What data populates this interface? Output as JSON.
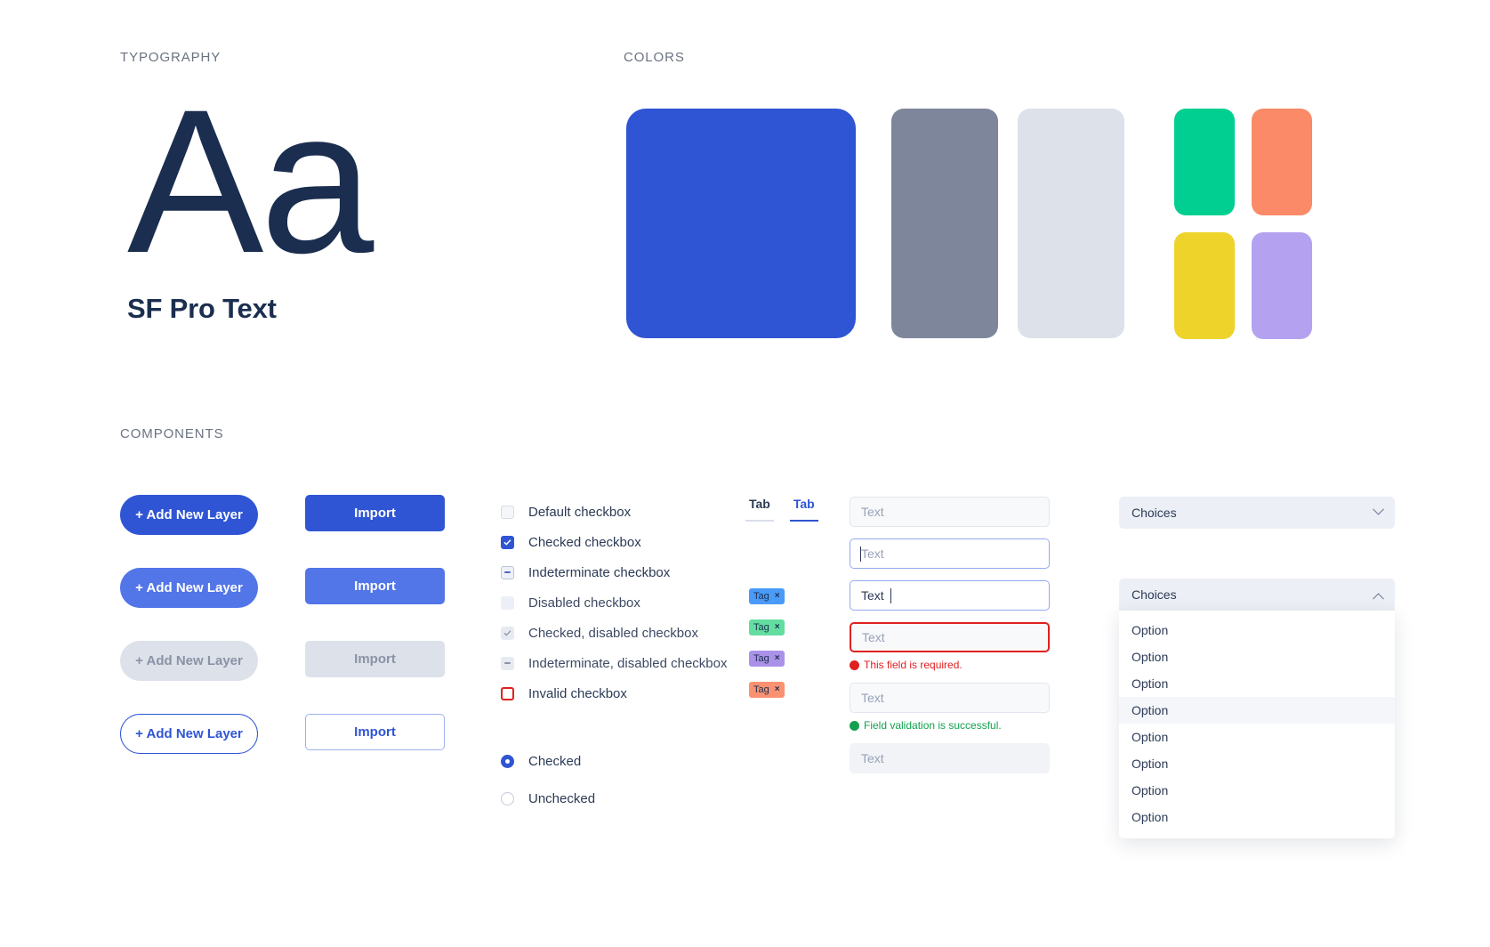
{
  "sections": {
    "typography_label": "TYPOGRAPHY",
    "colors_label": "COLORS",
    "components_label": "COMPONENTS"
  },
  "typography": {
    "sample_glyphs": "Aa",
    "font_name": "SF Pro Text"
  },
  "colors": {
    "primary": "#2f55d4",
    "gray": "#7e869b",
    "light_gray": "#dde1ea",
    "green": "#00cf91",
    "orange": "#fa8a68",
    "yellow": "#eed32a",
    "purple": "#b4a2f0",
    "swatches": [
      {
        "name": "primary-blue",
        "hex": "#2f55d4"
      },
      {
        "name": "slate-gray",
        "hex": "#7e869b"
      },
      {
        "name": "light-gray",
        "hex": "#dde1ea"
      },
      {
        "name": "green",
        "hex": "#00cf91"
      },
      {
        "name": "orange",
        "hex": "#fa8a68"
      },
      {
        "name": "yellow",
        "hex": "#eed32a"
      },
      {
        "name": "purple",
        "hex": "#b4a2f0"
      }
    ]
  },
  "buttons": {
    "pill_label": "+ Add New Layer",
    "rect_label": "Import",
    "states": [
      "default",
      "hover",
      "disabled",
      "outline"
    ]
  },
  "checkboxes": [
    {
      "label": "Default checkbox",
      "state": "default"
    },
    {
      "label": "Checked checkbox",
      "state": "checked"
    },
    {
      "label": "Indeterminate checkbox",
      "state": "indeterminate"
    },
    {
      "label": "Disabled checkbox",
      "state": "disabled"
    },
    {
      "label": "Checked, disabled checkbox",
      "state": "checked-disabled"
    },
    {
      "label": "Indeterminate, disabled checkbox",
      "state": "indeterminate-disabled"
    },
    {
      "label": "Invalid checkbox",
      "state": "invalid"
    }
  ],
  "radios": [
    {
      "label": "Checked",
      "state": "checked"
    },
    {
      "label": "Unchecked",
      "state": "unchecked"
    }
  ],
  "tabs": [
    {
      "label": "Tab",
      "active": false
    },
    {
      "label": "Tab",
      "active": true
    }
  ],
  "tags": [
    {
      "label": "Tag",
      "close": "×",
      "color": "#4a9bf7"
    },
    {
      "label": "Tag",
      "close": "×",
      "color": "#63dda0"
    },
    {
      "label": "Tag",
      "close": "×",
      "color": "#a992e8"
    },
    {
      "label": "Tag",
      "close": "×",
      "color": "#fa9272"
    }
  ],
  "inputs": {
    "placeholder": "Text",
    "filled_value": "Text",
    "error_message": "This field is required.",
    "success_message": "Field validation is successful.",
    "fields": [
      {
        "state": "default",
        "value": "",
        "placeholder": "Text"
      },
      {
        "state": "focus",
        "value": "",
        "placeholder": "Text"
      },
      {
        "state": "filled",
        "value": "Text",
        "placeholder": ""
      },
      {
        "state": "error",
        "value": "",
        "placeholder": "Text"
      },
      {
        "state": "success",
        "value": "",
        "placeholder": "Text"
      },
      {
        "state": "disabled",
        "value": "",
        "placeholder": "Text"
      }
    ]
  },
  "select": {
    "closed_label": "Choices",
    "open_label": "Choices",
    "options": [
      "Option",
      "Option",
      "Option",
      "Option",
      "Option",
      "Option",
      "Option",
      "Option"
    ],
    "highlighted_index": 3
  }
}
